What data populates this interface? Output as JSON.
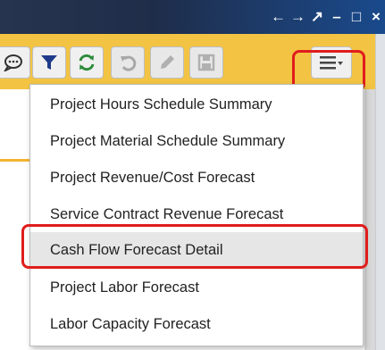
{
  "window_controls": {
    "back": "←",
    "forward": "→",
    "popout": "↗",
    "minimize": "–",
    "maximize": "□",
    "close": "×"
  },
  "toolbar": {
    "buttons": [
      {
        "name": "comment",
        "icon": "comment-icon"
      },
      {
        "name": "filter",
        "icon": "filter-icon"
      },
      {
        "name": "refresh",
        "icon": "refresh-icon"
      },
      {
        "name": "undo",
        "icon": "undo-icon"
      },
      {
        "name": "edit",
        "icon": "pencil-icon"
      },
      {
        "name": "save",
        "icon": "save-icon"
      },
      {
        "name": "menu",
        "icon": "hamburger-menu-icon"
      }
    ]
  },
  "menu": {
    "items": [
      {
        "label": "Project Hours Schedule Summary"
      },
      {
        "label": "Project Material Schedule Summary"
      },
      {
        "label": "Project Revenue/Cost Forecast"
      },
      {
        "label": "Service Contract Revenue Forecast"
      },
      {
        "label": "Cash Flow Forecast Detail"
      },
      {
        "label": "Project Labor Forecast"
      },
      {
        "label": "Labor Capacity Forecast"
      }
    ]
  },
  "colors": {
    "titlebar": "#1f2d4a",
    "toolbar": "#f3c443",
    "highlight": "#e01d1d",
    "filter_blue": "#1e3a8a",
    "refresh_green": "#2e8b3a"
  }
}
